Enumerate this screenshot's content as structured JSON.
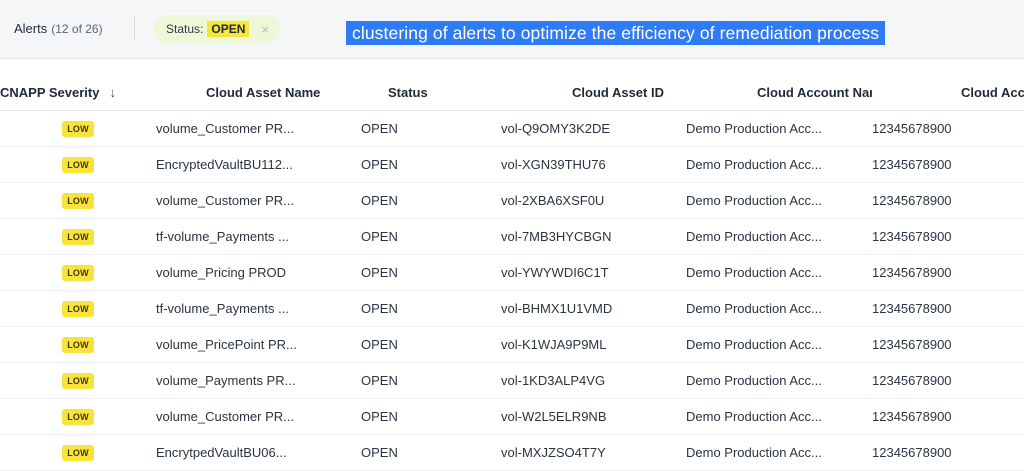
{
  "header": {
    "title": "Alerts",
    "count": "(12 of 26)",
    "filter_label": "Status:",
    "filter_value": "OPEN",
    "filter_close": "×"
  },
  "banner": {
    "text": "clustering of alerts to optimize the efficiency of remediation process"
  },
  "table": {
    "columns": {
      "severity": "CNAPP Severity",
      "sort_icon": "↓",
      "asset_name": "Cloud Asset Name",
      "status": "Status",
      "asset_id": "Cloud Asset ID",
      "account_name": "Cloud Account Name",
      "account_id": "Cloud Accou"
    },
    "rows": [
      {
        "severity": "LOW",
        "asset_name": "volume_Customer PR...",
        "status": "OPEN",
        "asset_id": "vol-Q9OMY3K2DE",
        "account_name": "Demo Production Acc...",
        "account_id": "12345678900"
      },
      {
        "severity": "LOW",
        "asset_name": "EncryptedVaultBU112...",
        "status": "OPEN",
        "asset_id": "vol-XGN39THU76",
        "account_name": "Demo Production Acc...",
        "account_id": "12345678900"
      },
      {
        "severity": "LOW",
        "asset_name": "volume_Customer PR...",
        "status": "OPEN",
        "asset_id": "vol-2XBA6XSF0U",
        "account_name": "Demo Production Acc...",
        "account_id": "12345678900"
      },
      {
        "severity": "LOW",
        "asset_name": "tf-volume_Payments ...",
        "status": "OPEN",
        "asset_id": "vol-7MB3HYCBGN",
        "account_name": "Demo Production Acc...",
        "account_id": "12345678900"
      },
      {
        "severity": "LOW",
        "asset_name": "volume_Pricing PROD",
        "status": "OPEN",
        "asset_id": "vol-YWYWDI6C1T",
        "account_name": "Demo Production Acc...",
        "account_id": "12345678900"
      },
      {
        "severity": "LOW",
        "asset_name": "tf-volume_Payments ...",
        "status": "OPEN",
        "asset_id": "vol-BHMX1U1VMD",
        "account_name": "Demo Production Acc...",
        "account_id": "12345678900"
      },
      {
        "severity": "LOW",
        "asset_name": "volume_PricePoint PR...",
        "status": "OPEN",
        "asset_id": "vol-K1WJA9P9ML",
        "account_name": "Demo Production Acc...",
        "account_id": "12345678900"
      },
      {
        "severity": "LOW",
        "asset_name": "volume_Payments PR...",
        "status": "OPEN",
        "asset_id": "vol-1KD3ALP4VG",
        "account_name": "Demo Production Acc...",
        "account_id": "12345678900"
      },
      {
        "severity": "LOW",
        "asset_name": "volume_Customer PR...",
        "status": "OPEN",
        "asset_id": "vol-W2L5ELR9NB",
        "account_name": "Demo Production Acc...",
        "account_id": "12345678900"
      },
      {
        "severity": "LOW",
        "asset_name": "EncrytpedVaultBU06...",
        "status": "OPEN",
        "asset_id": "vol-MXJZSO4T7Y",
        "account_name": "Demo Production Acc...",
        "account_id": "12345678900"
      }
    ]
  }
}
